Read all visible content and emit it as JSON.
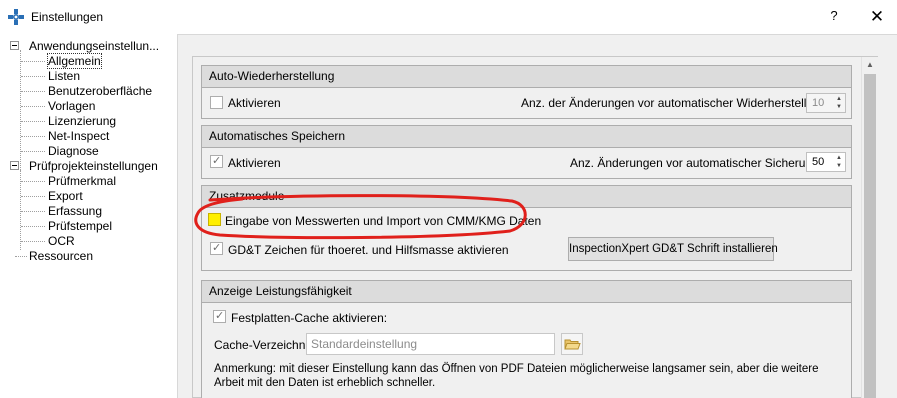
{
  "window": {
    "title": "Einstellungen",
    "help_label": "?",
    "close_label": "✕"
  },
  "tree": {
    "app_settings": "Anwendungseinstellun...",
    "app_children": [
      "Allgemein",
      "Listen",
      "Benutzeroberfläche",
      "Vorlagen",
      "Lizenzierung",
      "Net-Inspect",
      "Diagnose"
    ],
    "project_settings": "Prüfprojekteinstellungen",
    "project_children": [
      "Prüfmerkmal",
      "Export",
      "Erfassung",
      "Prüfstempel",
      "OCR"
    ],
    "resources": "Ressourcen",
    "selected": "Allgemein"
  },
  "auto_restore": {
    "title": "Auto-Wiederherstellung",
    "activate_label": "Aktivieren",
    "activate_checked": false,
    "changes_label": "Anz. der Änderungen vor automatischer Widerherstellung",
    "changes_value": "10"
  },
  "auto_save": {
    "title": "Automatisches Speichern",
    "activate_label": "Aktivieren",
    "activate_checked": true,
    "changes_label": "Anz. Änderungen vor automatischer Sicherung:",
    "changes_value": "50"
  },
  "addons": {
    "title": "Zusatzmodule",
    "cmm_label": "Eingabe von Messwerten und Import von CMM/KMG Daten",
    "gdt_label": "GD&T Zeichen für thoeret. und Hilfsmasse aktivieren",
    "gdt_checked": true,
    "install_button": "InspectionXpert GD&T Schrift installieren"
  },
  "performance": {
    "title": "Anzeige Leistungsfähigkeit",
    "cache_label": "Festplatten-Cache aktivieren:",
    "cache_checked": true,
    "dir_label": "Cache-Verzeichnis",
    "dir_placeholder": "Standardeinstellung",
    "note": "Anmerkung: mit dieser Einstellung kann das Öffnen von PDF Dateien möglicherweise langsamer sein, aber die weitere Arbeit mit den Daten ist erheblich schneller."
  },
  "colors": {
    "highlight_circle": "#e0201b",
    "group_header": "#dcdcdc",
    "cmm_checkbox": "#ffef00"
  }
}
